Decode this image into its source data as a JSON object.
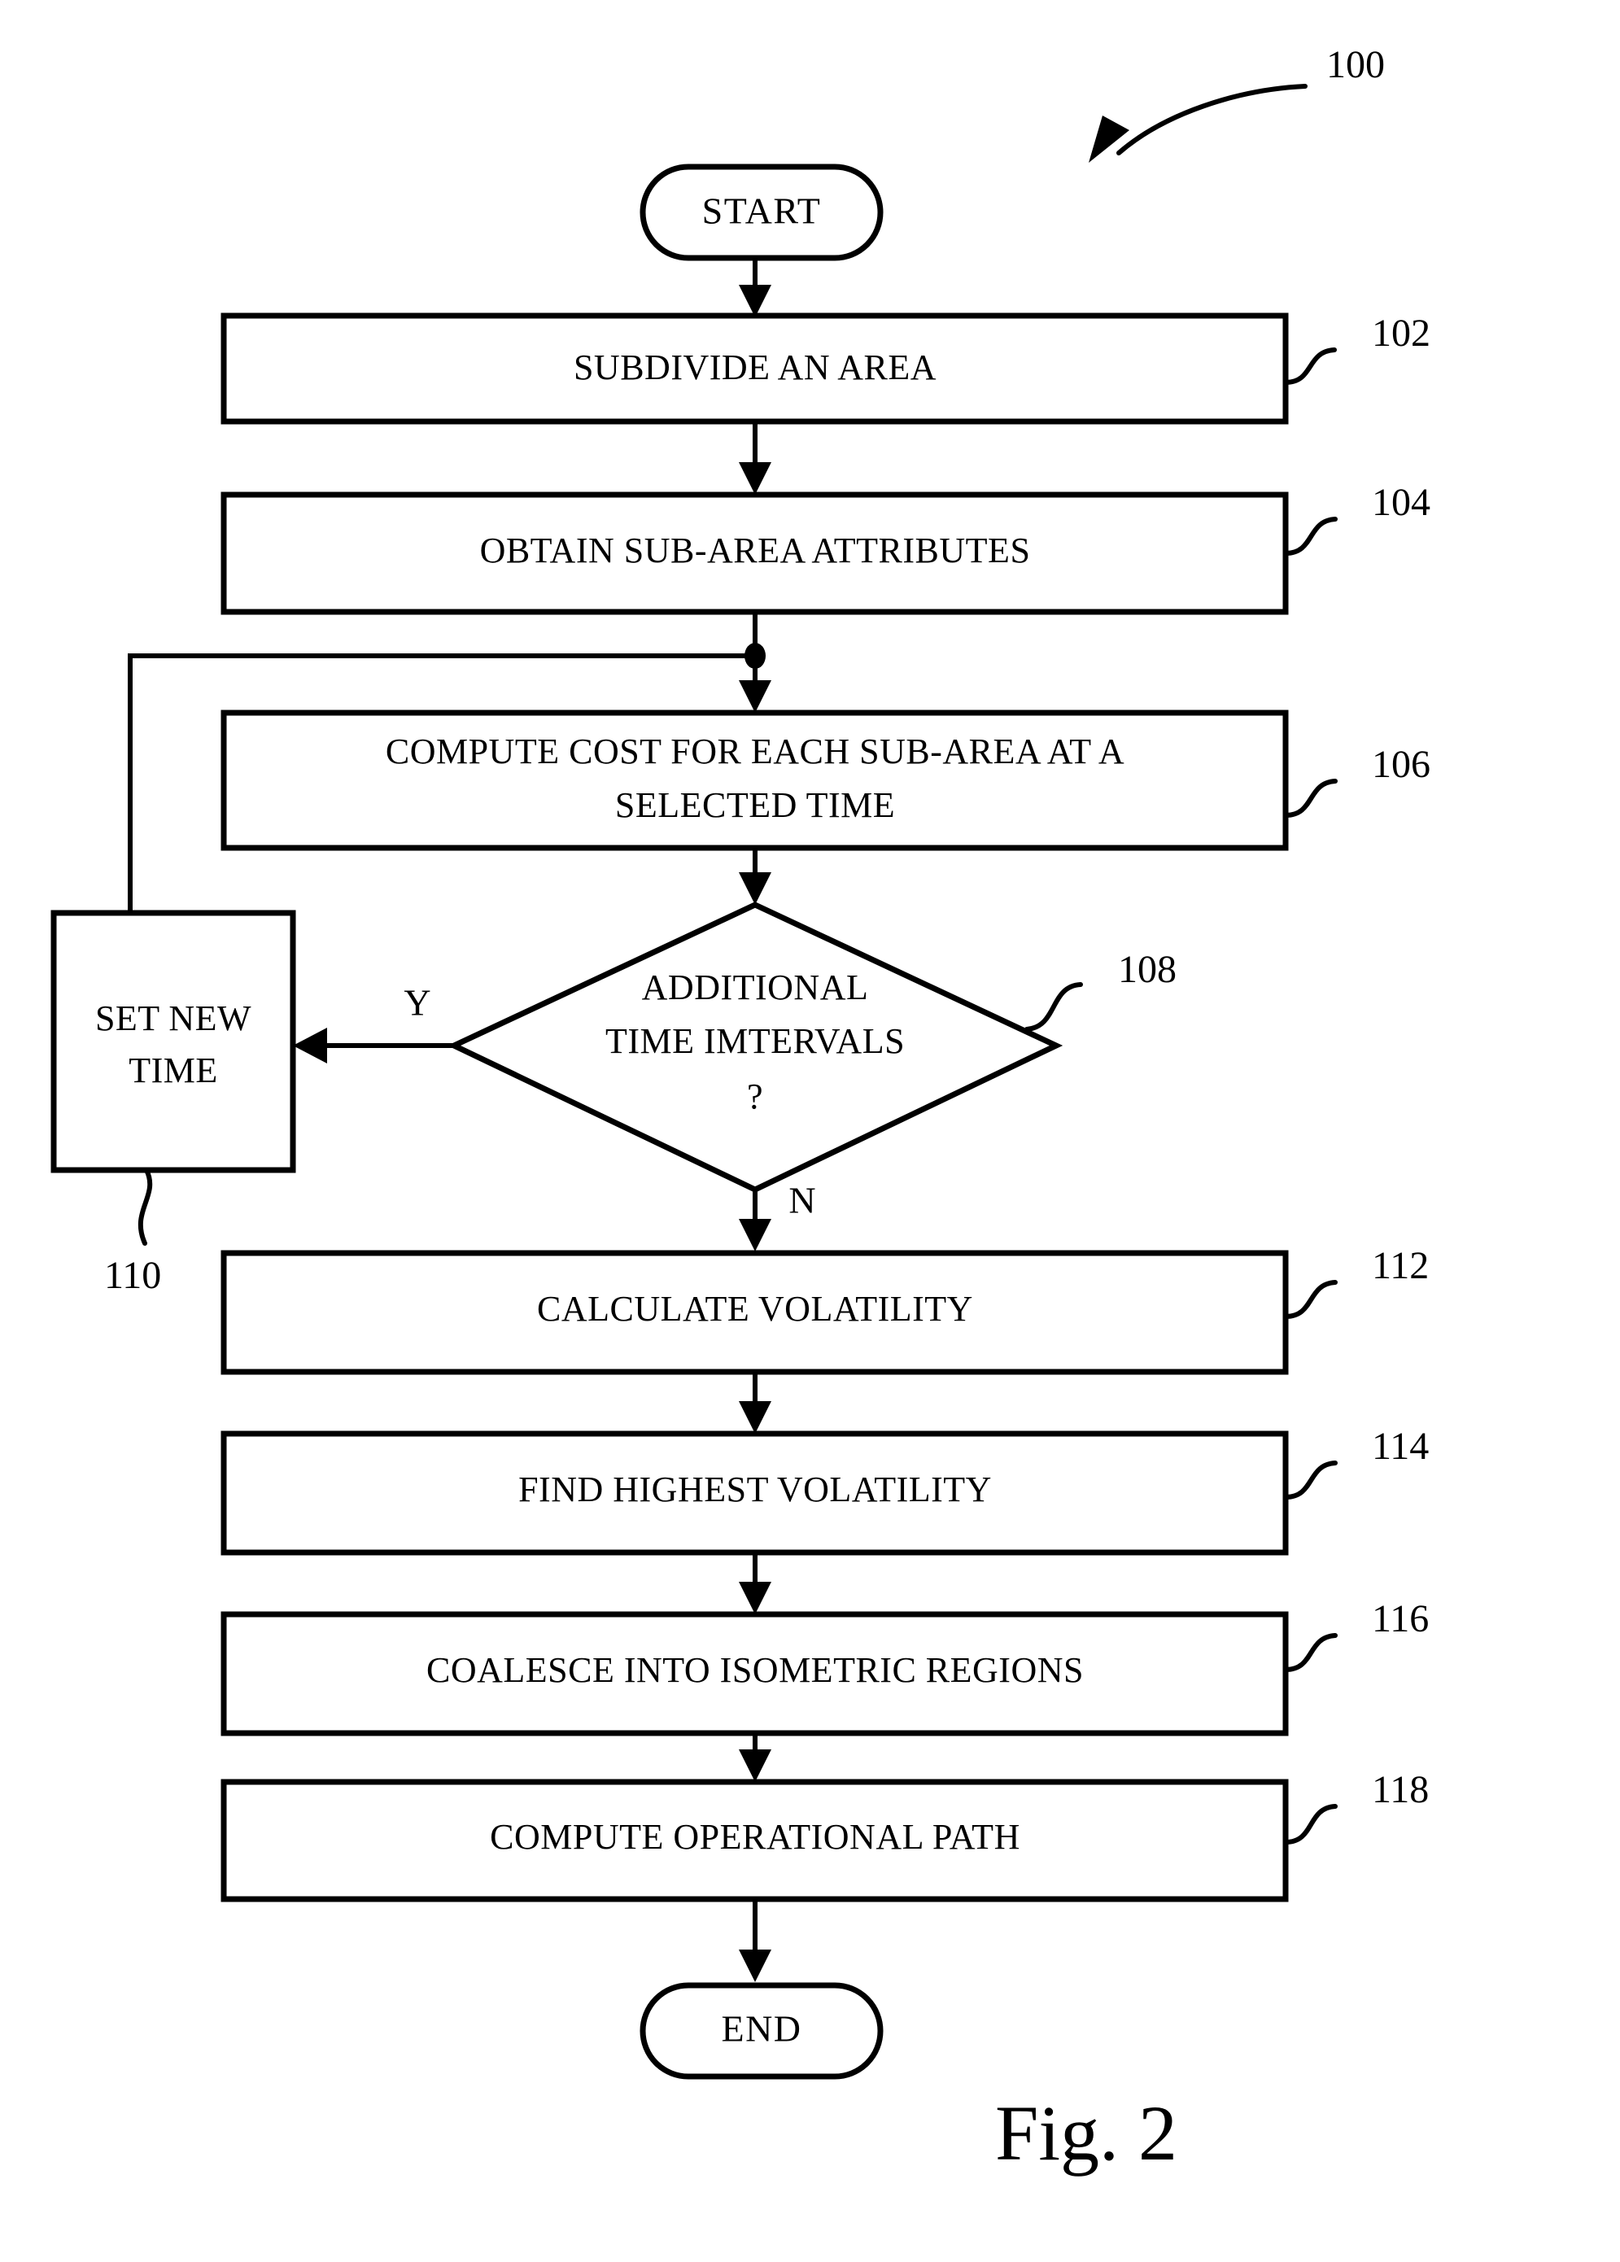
{
  "figure": {
    "caption": "Fig. 2",
    "diagram_reference": "100"
  },
  "nodes": {
    "start": {
      "label": "START",
      "shape": "terminator"
    },
    "step_102": {
      "label": "SUBDIVIDE AN AREA",
      "ref": "102",
      "shape": "process"
    },
    "step_104": {
      "label": "OBTAIN SUB-AREA ATTRIBUTES",
      "ref": "104",
      "shape": "process"
    },
    "step_106": {
      "label_line1": "COMPUTE COST FOR EACH SUB-AREA AT A",
      "label_line2": "SELECTED TIME",
      "ref": "106",
      "shape": "process"
    },
    "decision_108": {
      "label_line1": "ADDITIONAL",
      "label_line2": "TIME IMTERVALS",
      "label_line3": "?",
      "ref": "108",
      "shape": "decision"
    },
    "step_110": {
      "label_line1": "SET NEW",
      "label_line2": "TIME",
      "ref": "110",
      "shape": "process"
    },
    "step_112": {
      "label": "CALCULATE VOLATILITY",
      "ref": "112",
      "shape": "process"
    },
    "step_114": {
      "label": "FIND HIGHEST VOLATILITY",
      "ref": "114",
      "shape": "process"
    },
    "step_116": {
      "label": "COALESCE INTO ISOMETRIC REGIONS",
      "ref": "116",
      "shape": "process"
    },
    "step_118": {
      "label": "COMPUTE OPERATIONAL PATH",
      "ref": "118",
      "shape": "process"
    },
    "end": {
      "label": "END",
      "shape": "terminator"
    }
  },
  "branches": {
    "yes": "Y",
    "no": "N"
  },
  "colors": {
    "ink": "#000000",
    "paper": "#ffffff"
  }
}
